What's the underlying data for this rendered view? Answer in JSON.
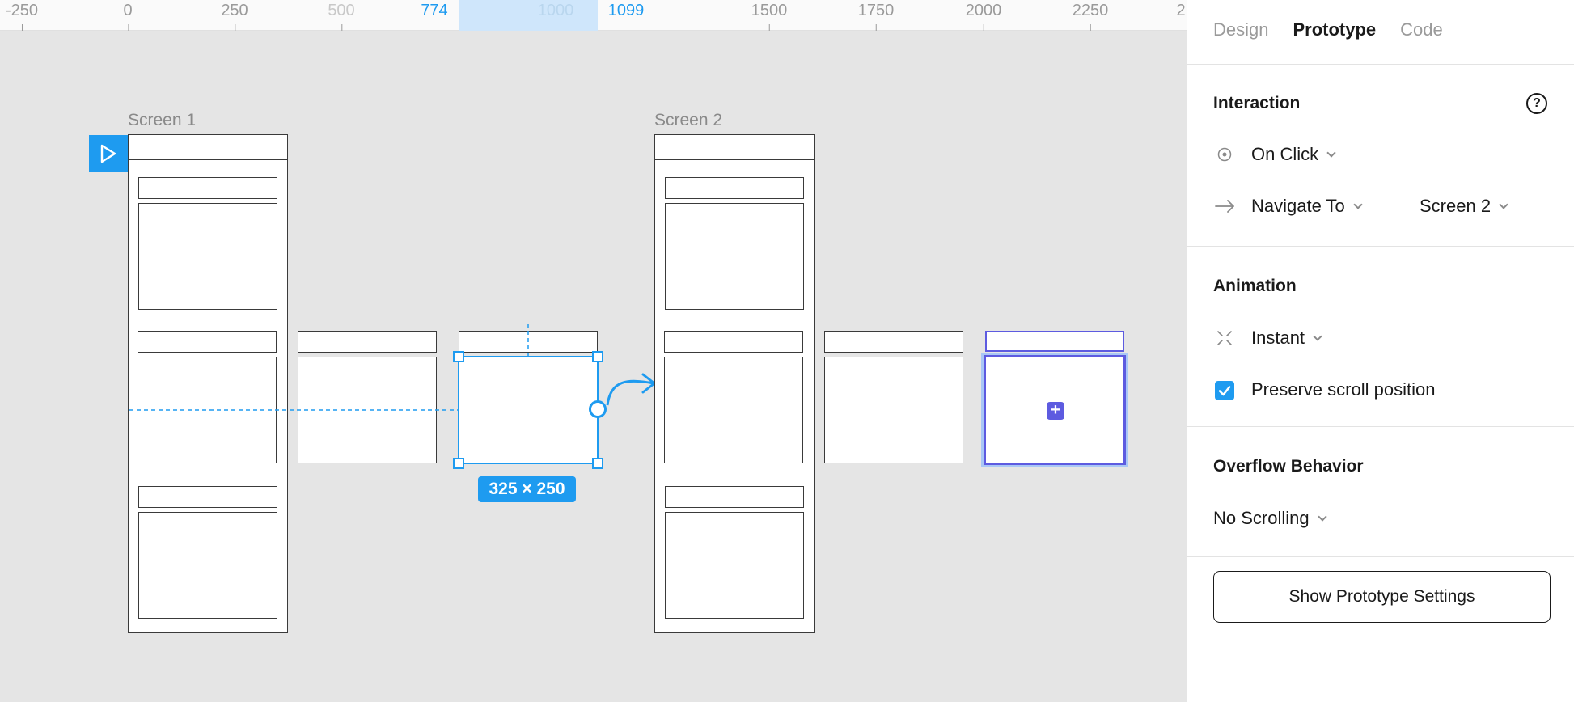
{
  "ruler": {
    "ticks": [
      "-250",
      "0",
      "250",
      "500",
      "774",
      "1000",
      "1099",
      "1500",
      "1750",
      "2000",
      "2250",
      "2"
    ]
  },
  "canvas": {
    "frames": [
      {
        "label": "Screen 1"
      },
      {
        "label": "Screen 2"
      }
    ],
    "selection_size": "325 × 250"
  },
  "panel": {
    "tabs": [
      "Design",
      "Prototype",
      "Code"
    ],
    "active_tab": "Prototype",
    "interaction": {
      "title": "Interaction",
      "help_glyph": "?",
      "trigger": "On Click",
      "action": "Navigate To",
      "destination": "Screen 2"
    },
    "animation": {
      "title": "Animation",
      "type": "Instant",
      "preserve_scroll_label": "Preserve scroll position",
      "preserve_scroll_checked": true
    },
    "overflow": {
      "title": "Overflow Behavior",
      "value": "No Scrolling"
    },
    "settings_button": "Show Prototype Settings"
  },
  "colors": {
    "accent": "#1e9bf0",
    "purple": "#5d5be0",
    "canvas_bg": "#e5e5e5"
  }
}
